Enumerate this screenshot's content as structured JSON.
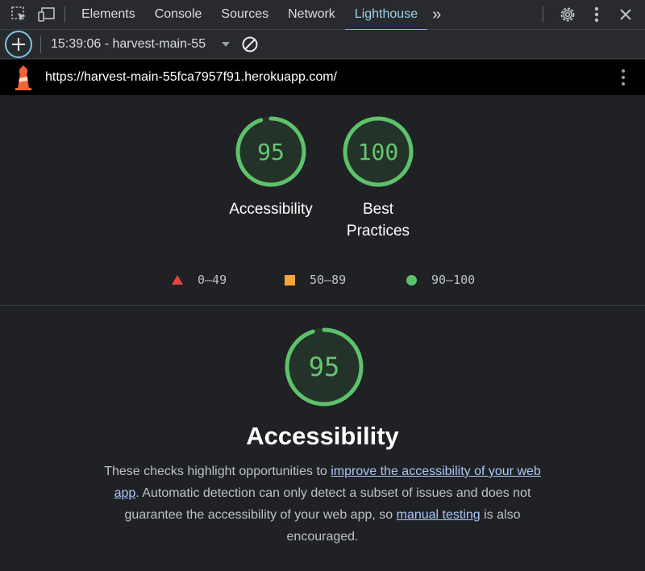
{
  "devtools": {
    "tabs": [
      {
        "label": "Elements"
      },
      {
        "label": "Console"
      },
      {
        "label": "Sources"
      },
      {
        "label": "Network"
      },
      {
        "label": "Lighthouse",
        "active": true
      }
    ],
    "more_tabs_label": "»"
  },
  "lighthouse_toolbar": {
    "report_label": "15:39:06 - harvest-main-55"
  },
  "urlbar": {
    "url": "https://harvest-main-55fca7957f91.herokuapp.com/"
  },
  "scores": [
    {
      "value": "95",
      "score": 95,
      "label": "Accessibility",
      "color": "#5ec26a"
    },
    {
      "value": "100",
      "score": 100,
      "label_line1": "Best",
      "label_line2": "Practices",
      "color": "#5ec26a"
    }
  ],
  "legend": {
    "fail": "0–49",
    "average": "50–89",
    "pass": "90–100",
    "colors": {
      "fail": "#e2453c",
      "average": "#f5a53b",
      "pass": "#5ec26a"
    }
  },
  "category": {
    "score_value": "95",
    "score": 95,
    "title": "Accessibility",
    "desc_part1": "These checks highlight opportunities to ",
    "desc_link1": "improve the accessibility of your web app",
    "desc_part2": ". Automatic detection can only detect a subset of issues and does not guarantee the accessibility of your web app, so ",
    "desc_link2": "manual testing",
    "desc_part3": " is also encouraged."
  }
}
